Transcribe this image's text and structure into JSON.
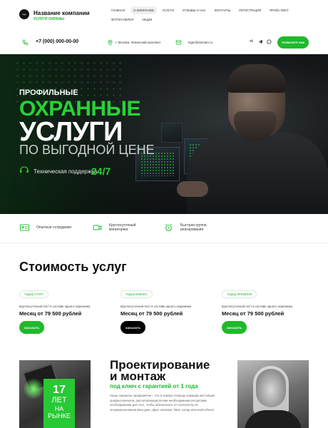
{
  "header": {
    "logo_text": "logo",
    "company_name": "Название компании",
    "company_tagline": "УСЛУГИ ОХРАНЫ",
    "nav": [
      {
        "label": "ГЛАВНАЯ",
        "active": false
      },
      {
        "label": "О КОМПАНИИ",
        "active": true
      },
      {
        "label": "УСЛУГИ",
        "active": false
      },
      {
        "label": "ОТЗЫВЫ О НАС",
        "active": false
      },
      {
        "label": "КОНТАКТЫ",
        "active": false
      },
      {
        "label": "РЕГИСТРАЦИЯ",
        "active": false
      },
      {
        "label": "ПРАЙС-ЛИСТ",
        "active": false
      },
      {
        "label": "ФОТОГАЛЕРЕЯ",
        "active": false
      },
      {
        "label": "АКЦИИ",
        "active": false
      }
    ]
  },
  "contacts": {
    "phone": "+7 (000) 000-00-00",
    "address": "г. Москва, Ленинский проспект",
    "email": "login@domain.ru",
    "social": [
      "vk",
      "telegram",
      "whatsapp"
    ],
    "call_button": "ПОЗВОНИТЕ НАМ"
  },
  "hero": {
    "pre_title": "ПРОФИЛЬНЫЕ",
    "title_green": "ОХРАННЫЕ",
    "title_white": "УСЛУГИ",
    "subtitle": "ПО ВЫГОДНОЙ ЦЕНЕ",
    "support_label": "Техническая поддержка",
    "support_value": "24/7"
  },
  "features": [
    {
      "icon": "id-card-icon",
      "label": "Опытные сотрудники"
    },
    {
      "icon": "camera-icon",
      "label": "Круглосуточный мониторинг"
    },
    {
      "icon": "alarm-icon",
      "label": "Быстрая группа реагирования"
    }
  ],
  "prices": {
    "title": "Стоимость услуг",
    "cards": [
      {
        "badge": "Тариф СТАРТ",
        "desc": "Круглосуточный пост в составе одного охранника",
        "price": "Месяц от 79 500 рублей",
        "button": "ЗАКАЗАТЬ",
        "button_color": "#1fb92c"
      },
      {
        "badge": "Тариф БИЗНЕС",
        "desc": "Круглосуточный пост в составе одного охранника",
        "price": "Месяц от 79 500 рублей",
        "button": "ЗАКАЗАТЬ",
        "button_color": "#000000"
      },
      {
        "badge": "Тариф ПРЕМИУМ",
        "desc": "Круглосуточный пост в составе одного охранника",
        "price": "Месяц от 79 500 рублей",
        "button": "ЗАКАЗАТЬ",
        "button_color": "#1fb92c"
      }
    ]
  },
  "about": {
    "years_number": "17",
    "years_unit": "ЛЕТ",
    "years_text1": "НА",
    "years_text2": "РЫНКЕ",
    "title_line1": "Проектирование",
    "title_line2": "и монтаж",
    "subtitle": "под ключ с гарантией от 1 года",
    "text": "Наше охранное предприятие – это в первую очередь команда настоящих профессионалов, располагающих всеми необходимыми ресурсами, необходимыми для того, чтобы обезопасить от посягательств злоумышленников Ваш дом, офис, магазин, банк, склад или иной объект"
  },
  "colors": {
    "accent": "#1fb92c",
    "hero_green": "#27d335",
    "dark": "#111111"
  }
}
